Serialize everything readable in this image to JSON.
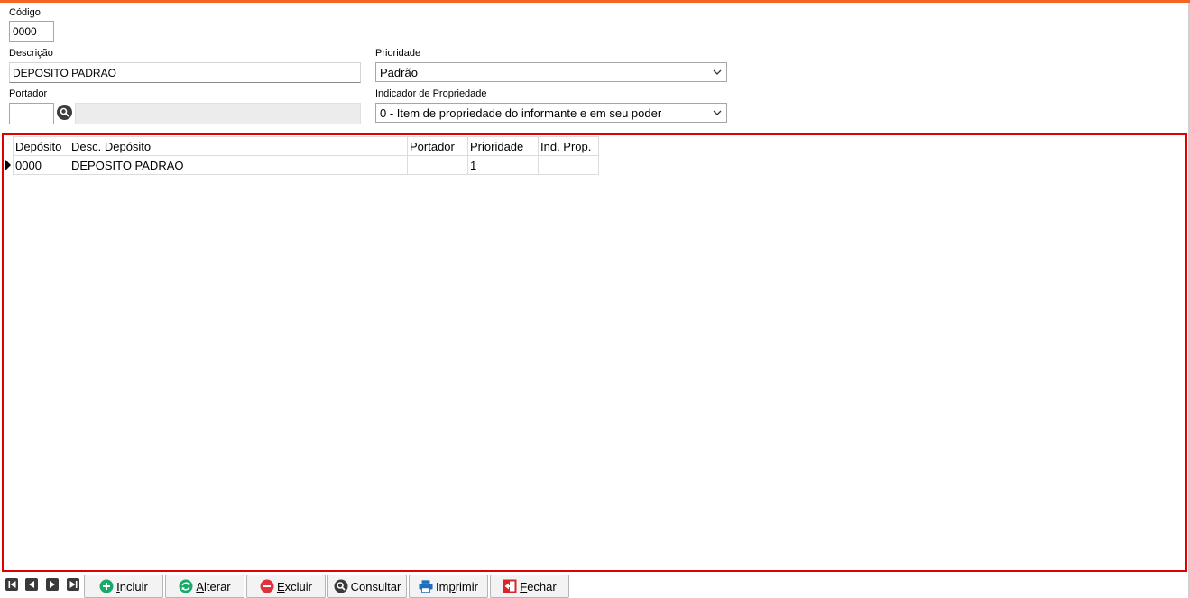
{
  "form": {
    "codigo": {
      "label": "Código",
      "value": "0000"
    },
    "descricao": {
      "label": "Descrição",
      "value": "DEPOSITO PADRAO"
    },
    "prioridade": {
      "label": "Prioridade",
      "value": "Padrão"
    },
    "portador": {
      "label": "Portador",
      "value": "",
      "name_value": ""
    },
    "indicador": {
      "label": "Indicador de Propriedade",
      "value": "0 - Item de propriedade do informante e em seu poder"
    }
  },
  "grid": {
    "columns": [
      "Depósito",
      "Desc. Depósito",
      "Portador",
      "Prioridade",
      "Ind. Prop."
    ],
    "rows": [
      [
        "0000",
        "DEPOSITO PADRAO",
        "",
        "1",
        ""
      ]
    ]
  },
  "toolbar": {
    "incluir": {
      "first": "I",
      "rest": "ncluir"
    },
    "alterar": {
      "first": "A",
      "rest": "lterar"
    },
    "excluir": {
      "first": "E",
      "rest": "xcluir"
    },
    "consultar": {
      "label": "Consultar"
    },
    "imprimir": {
      "pre": "Im",
      "ul": "p",
      "post": "rimir"
    },
    "fechar": {
      "first": "F",
      "rest": "echar"
    }
  },
  "colors": {
    "accent": "#f26522",
    "grid_border": "#e00000",
    "incluir": "#1aa86b",
    "alterar": "#1aa86b",
    "excluir": "#e0323c",
    "imprimir": "#1f6fbf",
    "fechar": "#d9262b"
  },
  "icons": [
    "search-icon",
    "first-record-icon",
    "prev-record-icon",
    "next-record-icon",
    "last-record-icon",
    "plus-icon",
    "refresh-icon",
    "minus-icon",
    "magnifier-icon",
    "printer-icon",
    "exit-icon",
    "chevron-down-icon"
  ]
}
